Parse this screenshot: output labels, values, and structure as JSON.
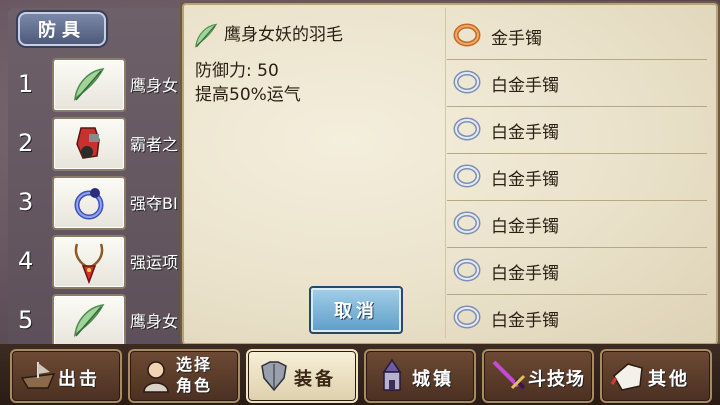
{
  "category_tab": "防具",
  "slots": [
    {
      "num": "1",
      "name": "鹰身女",
      "icon": "feather-icon"
    },
    {
      "num": "2",
      "name": "霸者之",
      "icon": "red-gauntlet-icon"
    },
    {
      "num": "3",
      "name": "强夺BI",
      "icon": "blue-ring-icon"
    },
    {
      "num": "4",
      "name": "强运项",
      "icon": "red-necklace-icon"
    },
    {
      "num": "5",
      "name": "鹰身女",
      "icon": "feather-icon"
    }
  ],
  "detail": {
    "item_name": "鹰身女妖的羽毛",
    "icon": "feather-icon",
    "defense": "防御力: 50",
    "effect": "提高50%运气"
  },
  "cancel_label": "取消",
  "inventory": [
    {
      "label": "金手镯",
      "icon": "gold-bracelet-icon"
    },
    {
      "label": "白金手镯",
      "icon": "platinum-bracelet-icon"
    },
    {
      "label": "白金手镯",
      "icon": "platinum-bracelet-icon"
    },
    {
      "label": "白金手镯",
      "icon": "platinum-bracelet-icon"
    },
    {
      "label": "白金手镯",
      "icon": "platinum-bracelet-icon"
    },
    {
      "label": "白金手镯",
      "icon": "platinum-bracelet-icon"
    },
    {
      "label": "白金手镯",
      "icon": "platinum-bracelet-icon"
    }
  ],
  "nav": [
    {
      "label": "出击",
      "icon": "ship-icon"
    },
    {
      "label": "选择角色",
      "line1": "选择",
      "line2": "角色",
      "icon": "character-icon"
    },
    {
      "label": "装备",
      "icon": "armor-icon",
      "active": true
    },
    {
      "label": "城镇",
      "icon": "town-icon"
    },
    {
      "label": "斗技场",
      "icon": "sword-icon"
    },
    {
      "label": "其他",
      "icon": "glove-icon"
    }
  ],
  "colors": {
    "parchment": "#ebe3cc",
    "text": "#2b1f14",
    "cancel": "#5d9ec9",
    "nav_active": "#f7f0d8"
  }
}
